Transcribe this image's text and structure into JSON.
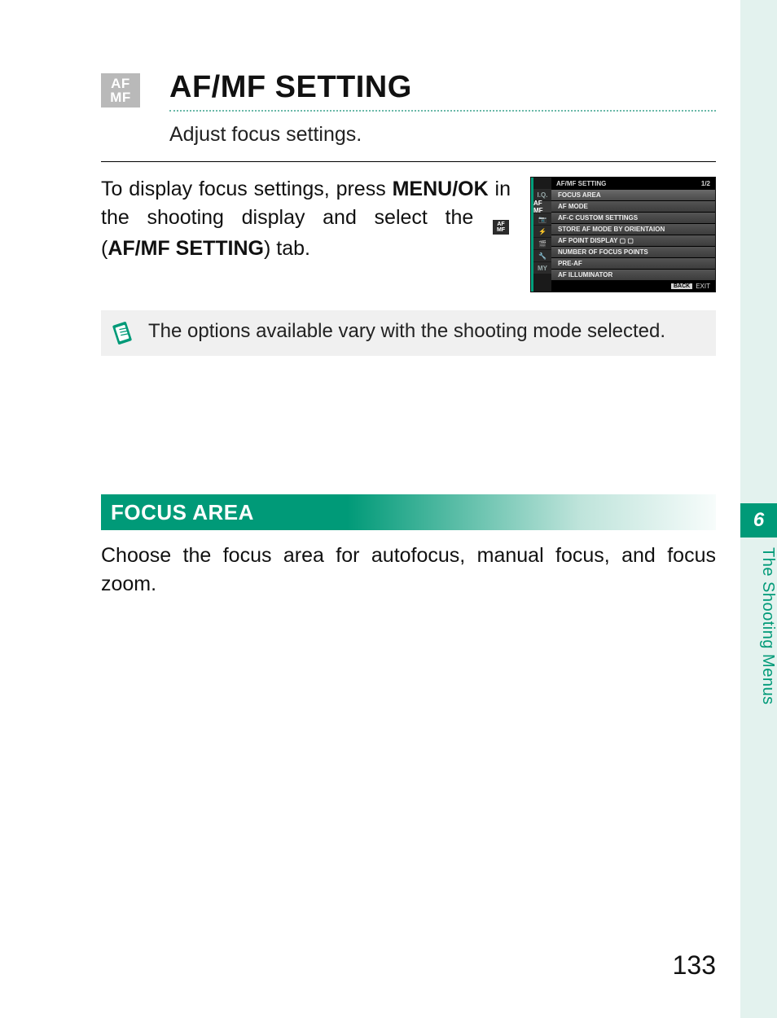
{
  "heading": {
    "icon": {
      "line1": "AF",
      "line2": "MF"
    },
    "title": "AF/MF SETTING",
    "subtitle": "Adjust focus settings."
  },
  "intro": {
    "pre": "To display focus settings, press ",
    "menu_ok": "MENU/OK",
    "mid": " in the shooting display and select the ",
    "tab_label_open": "(",
    "tab_label": "AF/MF SETTING",
    "tab_label_close": ")",
    "tail": " tab."
  },
  "menu_thumb": {
    "header_title": "AF/MF SETTING",
    "header_page": "1/2",
    "tabs": [
      "I.Q.",
      "AF MF",
      "📷",
      "⚡",
      "🎬",
      "🔧",
      "MY"
    ],
    "active_tab_index": 1,
    "items": [
      "FOCUS AREA",
      "AF MODE",
      "AF-C CUSTOM SETTINGS",
      "STORE AF MODE BY ORIENTAION",
      "AF POINT DISPLAY ▢ ▢",
      "NUMBER OF FOCUS POINTS",
      "PRE-AF",
      "AF ILLUMINATOR"
    ],
    "footer_back": "BACK",
    "footer_exit": "EXIT"
  },
  "note": {
    "text": "The options available vary with the shooting mode selected."
  },
  "section": {
    "title": "FOCUS AREA",
    "description": "Choose the focus area for autofocus, manual focus, and focus zoom."
  },
  "side": {
    "chapter_number": "6",
    "chapter_label": "The Shooting Menus"
  },
  "page_number": "133"
}
